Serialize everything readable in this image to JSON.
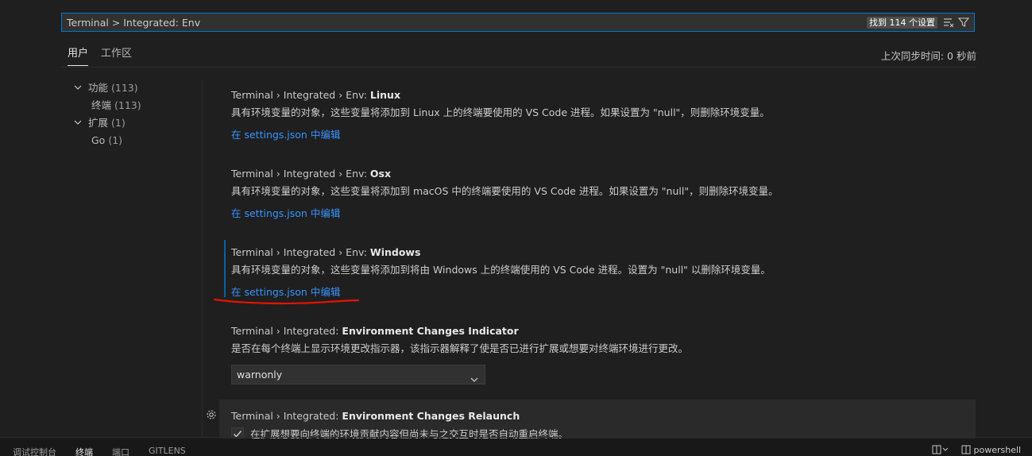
{
  "search": {
    "value": "Terminal > Integrated: Env",
    "results_badge": "找到 114 个设置"
  },
  "tabs": {
    "user": "用户",
    "workspace": "工作区"
  },
  "sync_status": "上次同步时间: 0 秒前",
  "toc": {
    "items": [
      {
        "label": "功能",
        "count": "(113)"
      },
      {
        "label": "终端",
        "count": "(113)"
      },
      {
        "label": "扩展",
        "count": "(1)"
      },
      {
        "label": "Go",
        "count": "(1)"
      }
    ]
  },
  "settings": [
    {
      "category": "Terminal › Integrated › Env: ",
      "label": "Linux",
      "description": "具有环境变量的对象，这些变量将添加到 Linux 上的终端要使用的 VS Code 进程。如果设置为 \"null\"，则删除环境变量。",
      "link": "在 settings.json 中编辑"
    },
    {
      "category": "Terminal › Integrated › Env: ",
      "label": "Osx",
      "description": "具有环境变量的对象，这些变量将添加到 macOS 中的终端要使用的 VS Code 进程。如果设置为 \"null\"，则删除环境变量。",
      "link": "在 settings.json 中编辑"
    },
    {
      "category": "Terminal › Integrated › Env: ",
      "label": "Windows",
      "description": "具有环境变量的对象，这些变量将添加到将由 Windows 上的终端使用的 VS Code 进程。设置为 \"null\" 以删除环境变量。",
      "link": "在 settings.json 中编辑"
    },
    {
      "category": "Terminal › Integrated: ",
      "label": "Environment Changes Indicator",
      "description": "是否在每个终端上显示环境更改指示器，该指示器解释了使是否已进行扩展或想要对终端环境进行更改。",
      "select_value": "warnonly"
    },
    {
      "category": "Terminal › Integrated: ",
      "label": "Environment Changes Relaunch",
      "checkbox_label": "在扩展想要向终端的环境贡献内容但尚未与之交互时是否自动重启终端。"
    }
  ],
  "panel": {
    "tabs": [
      "调试控制台",
      "终端",
      "端口",
      "GITLENS"
    ],
    "shell": "powershell"
  },
  "colors": {
    "accent": "#0078d4",
    "link": "#3794ff",
    "annotation": "#e51400"
  }
}
